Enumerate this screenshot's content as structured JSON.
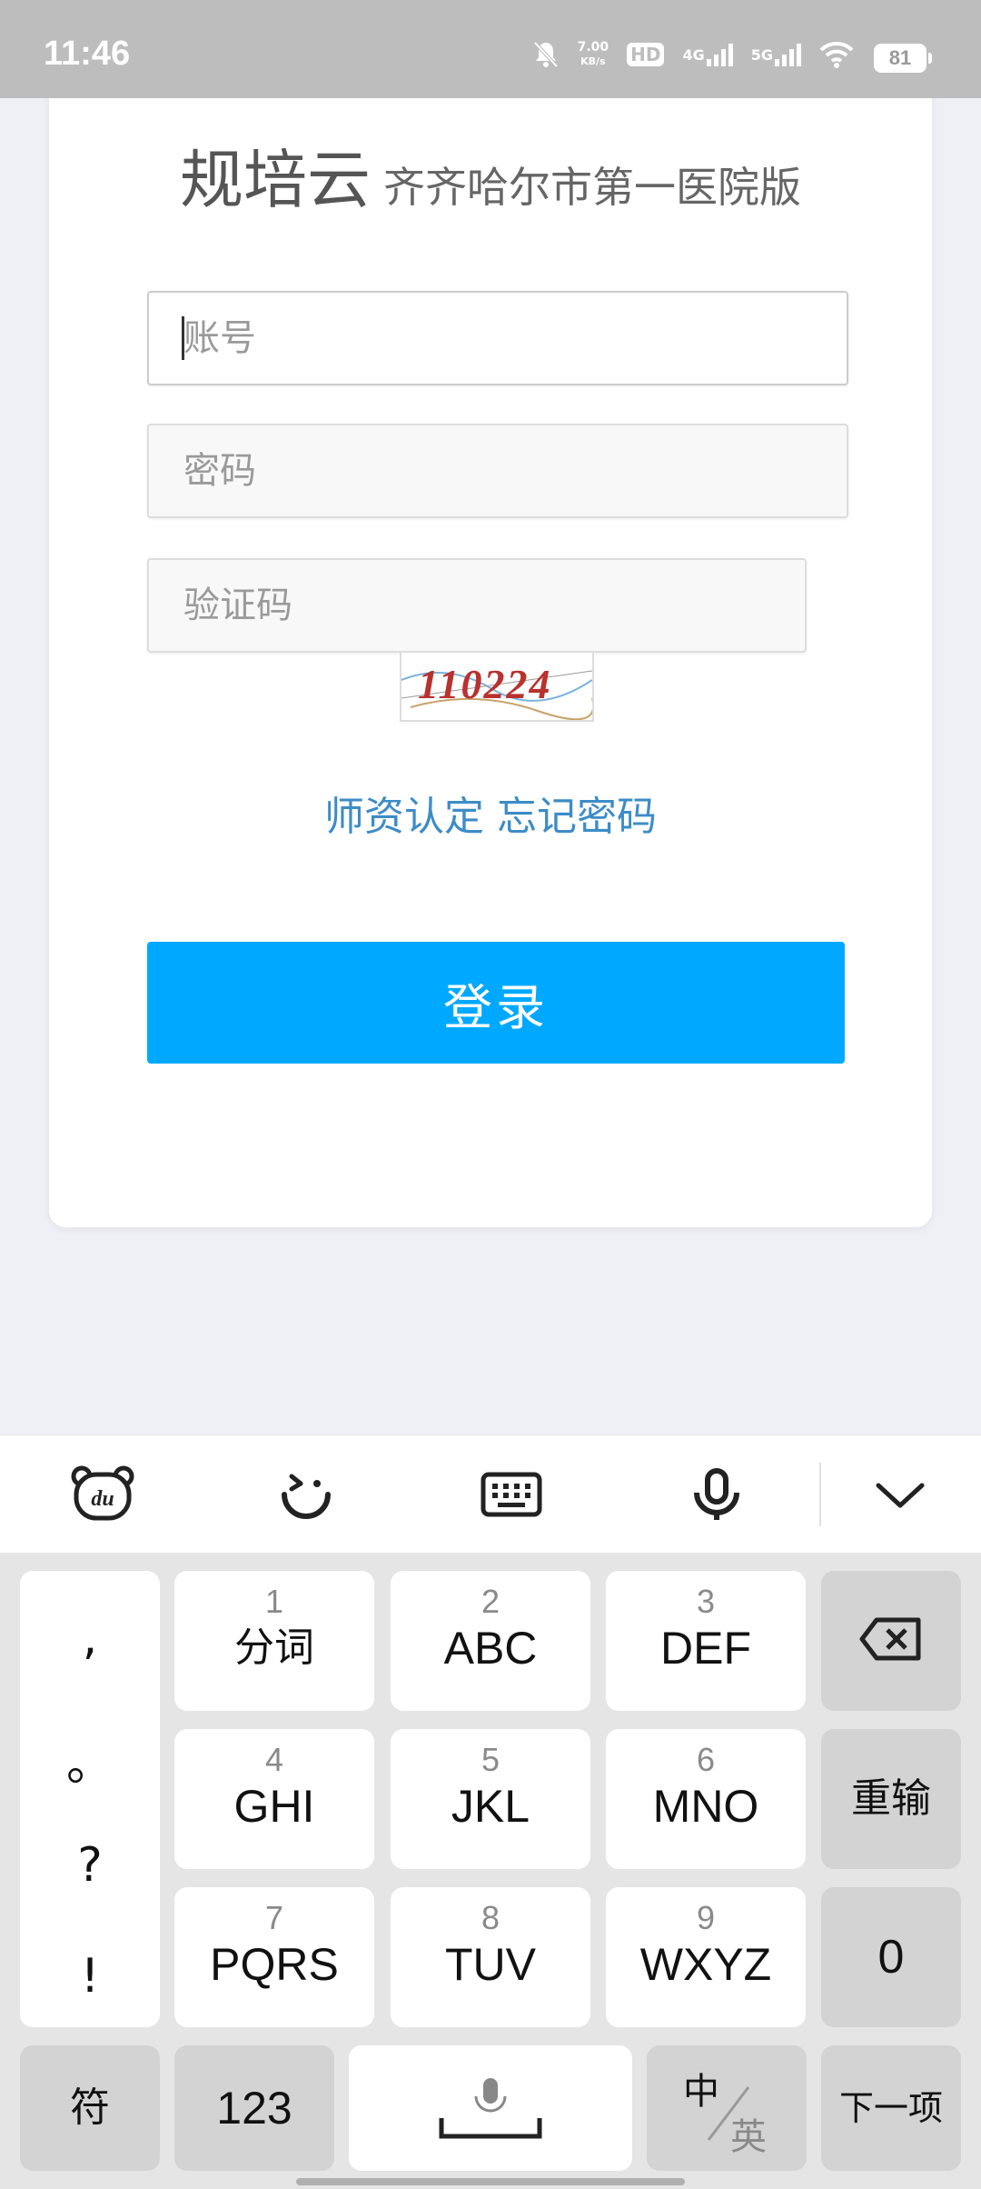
{
  "status_bar": {
    "time": "11:46",
    "net_speed_value": "7.00",
    "net_speed_unit": "KB/s",
    "hd_label": "HD",
    "sim1_label": "4G",
    "sim2_label": "5G",
    "battery": "81",
    "icons": [
      "bell-off-icon",
      "hd-icon",
      "cellular-4g-icon",
      "cellular-5g-icon",
      "wifi-icon",
      "battery-icon"
    ]
  },
  "app": {
    "title": "规培云",
    "subtitle": "齐齐哈尔市第一医院版"
  },
  "form": {
    "account_placeholder": "账号",
    "password_placeholder": "密码",
    "captcha_placeholder": "验证码",
    "captcha_text": "110224"
  },
  "links": {
    "teacher_cert": "师资认定",
    "forgot_password": "忘记密码"
  },
  "login_button": "登录",
  "keyboard": {
    "toolbar_icons": [
      "du-logo-icon",
      "emoji-icon",
      "keyboard-icon",
      "microphone-icon",
      "chevron-down-icon"
    ],
    "punctuation": [
      ",",
      "。",
      "?",
      "!"
    ],
    "keys": [
      {
        "num": "1",
        "label": "分词"
      },
      {
        "num": "2",
        "label": "ABC"
      },
      {
        "num": "3",
        "label": "DEF"
      },
      {
        "num": "4",
        "label": "GHI"
      },
      {
        "num": "5",
        "label": "JKL"
      },
      {
        "num": "6",
        "label": "MNO"
      },
      {
        "num": "7",
        "label": "PQRS"
      },
      {
        "num": "8",
        "label": "TUV"
      },
      {
        "num": "9",
        "label": "WXYZ"
      }
    ],
    "retype": "重输",
    "zero": "0",
    "symbols": "符",
    "numbers": "123",
    "lang_cn": "中",
    "lang_en": "英",
    "next": "下一项"
  },
  "colors": {
    "accent": "#00a9ff",
    "link": "#3d8cc7",
    "status_bar": "#bdbdbd"
  }
}
